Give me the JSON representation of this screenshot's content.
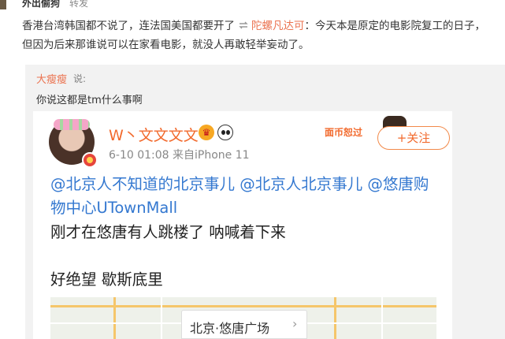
{
  "header": {
    "username": "外出偷狗",
    "action": "转发"
  },
  "post": {
    "text_part1": "香港台湾韩国都不说了，连法国美国都要开了",
    "loop_icon": "repost-loop-icon",
    "mention": "陀螺凡达可",
    "text_part2": "：今天本是原定的电影院复工的日子，但因为后来那谁说可以在家看电影，就没人再敢轻举妄动了。"
  },
  "repost": {
    "author": "大瘦瘦",
    "said": "说:",
    "text": "你说这都是tm什么事啊"
  },
  "screenshot": {
    "username": "W丶文文文文",
    "crown_icon": "crown-icon",
    "panda_icon": "panda-icon",
    "meta": "6-10 01:08  来自iPhone 11",
    "sticker_text": "面币恕过",
    "follow_label": "+关注",
    "mentions": "@北京人不知道的北京事儿 @北京人北京事儿 @悠唐购物中心UTownMall",
    "line1": "刚才在悠唐有人跳楼了 呐喊着下来",
    "line2": "好绝望 歇斯底里",
    "location": "北京·悠唐广场",
    "location_chevron": "›"
  },
  "colors": {
    "link": "#eb7350",
    "mention_blue": "#3478d0",
    "repost_bg": "#f2f2f2"
  }
}
